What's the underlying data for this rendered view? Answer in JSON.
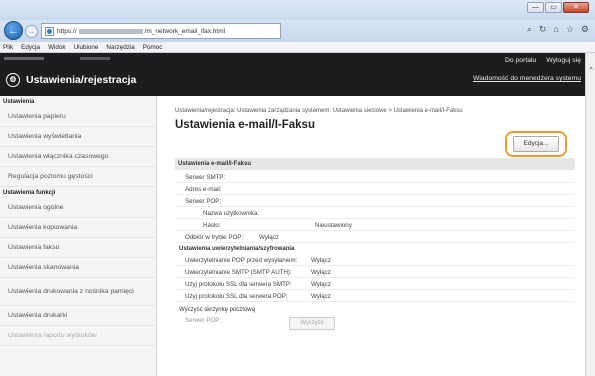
{
  "window": {
    "minimize": "—",
    "maximize": "▭",
    "close": "✕"
  },
  "nav": {
    "back_icon": "arrow-left-icon",
    "forward_icon": "arrow-right-icon",
    "url_prefix": "https://",
    "url_suffix": "/m_network_email_ifax.html",
    "icons": [
      "search-icon",
      "refresh-icon",
      "home-icon",
      "star-icon",
      "gear-icon"
    ]
  },
  "menu": [
    "Plik",
    "Edycja",
    "Widok",
    "Ulubione",
    "Narzędzia",
    "Pomoc"
  ],
  "app": {
    "title": "Ustawienia/rejestracja",
    "portal": "Do portalu",
    "logout": "Wyloguj się",
    "manager_msg": "Wiadomość do menedżera systemu"
  },
  "sidebar": {
    "heading": "Ustawienia",
    "items1": [
      "Ustawienia papieru",
      "Ustawienia wyświetlania",
      "Ustawienia włącznika czasowego",
      "Regulacja poziomu gęstości"
    ],
    "heading2": "Ustawienia funkcji",
    "items2": [
      "Ustawienia ogólne",
      "Ustawienia kopiowania",
      "Ustawienia faksu",
      "Ustawienia skanowania"
    ],
    "item_tall": "Ustawienia drukowania z nośnika pamięci",
    "items3": [
      "Ustawienia drukarki",
      "Ustawienia raportu wydruków"
    ]
  },
  "main": {
    "breadcrumb": "Ustawienia/rejestracja: Ustawienia zarządzania systemem: Ustawienia sieciowe > Ustawienia e-mail/I-Faksu",
    "title": "Ustawienia e-mail/I-Faksu",
    "edit_button": "Edycja...",
    "section1": "Ustawienia e-mail/I-Faksu",
    "smtp_server": "Serwer SMTP:",
    "email_address": "Adres e-mail:",
    "pop_server": "Serwer POP:",
    "username": "Nazwa użytkownika:",
    "password": "Hasło:",
    "password_value": "Nieustawiony",
    "pop_receive": "Odbiór w trybie POP:",
    "pop_receive_value": "Wyłącz",
    "section2": "Ustawienia uwierzytelniania/szyfrowania",
    "auth_rows": [
      {
        "label": "Uwierzytelnianie POP przed wysyłaniem:",
        "value": "Wyłącz"
      },
      {
        "label": "Uwierzytelnianie SMTP (SMTP AUTH):",
        "value": "Wyłącz"
      },
      {
        "label": "Użyj protokołu SSL dla serwera SMTP:",
        "value": "Wyłącz"
      },
      {
        "label": "Użyj protokołu SSL dla serwera POP:",
        "value": "Wyłącz"
      }
    ],
    "section3": "Wyczyść skrzynkę pocztową",
    "pop_server2": "Serwer POP:",
    "clear_button": "Wyczyść"
  }
}
